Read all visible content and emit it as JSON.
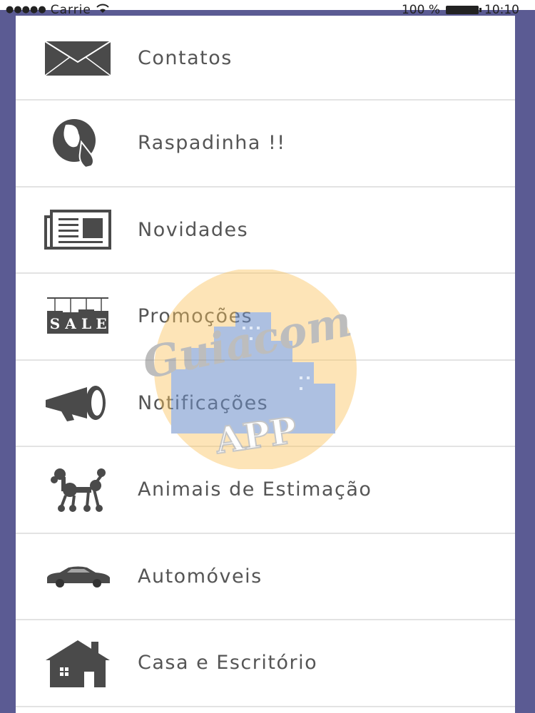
{
  "status_bar": {
    "carrier": "Carrie",
    "battery_percent": "100 %",
    "time": "10:10"
  },
  "menu": {
    "items": [
      {
        "label": "Contatos",
        "icon": "envelope-icon"
      },
      {
        "label": "Raspadinha !!",
        "icon": "scratch-card-icon"
      },
      {
        "label": "Novidades",
        "icon": "newspaper-icon"
      },
      {
        "label": "Promoções",
        "icon": "sale-tags-icon"
      },
      {
        "label": "Notificações",
        "icon": "megaphone-icon"
      },
      {
        "label": "Animais de Estimação",
        "icon": "poodle-icon"
      },
      {
        "label": "Automóveis",
        "icon": "car-icon"
      },
      {
        "label": "Casa e Escritório",
        "icon": "house-icon"
      }
    ]
  },
  "watermark": {
    "brand_text": "Guiacom",
    "sub_text": "APP"
  },
  "colors": {
    "frame": "#5b5b93",
    "icon": "#4a4a4a",
    "label": "#555555",
    "divider": "#e3e3e3"
  }
}
